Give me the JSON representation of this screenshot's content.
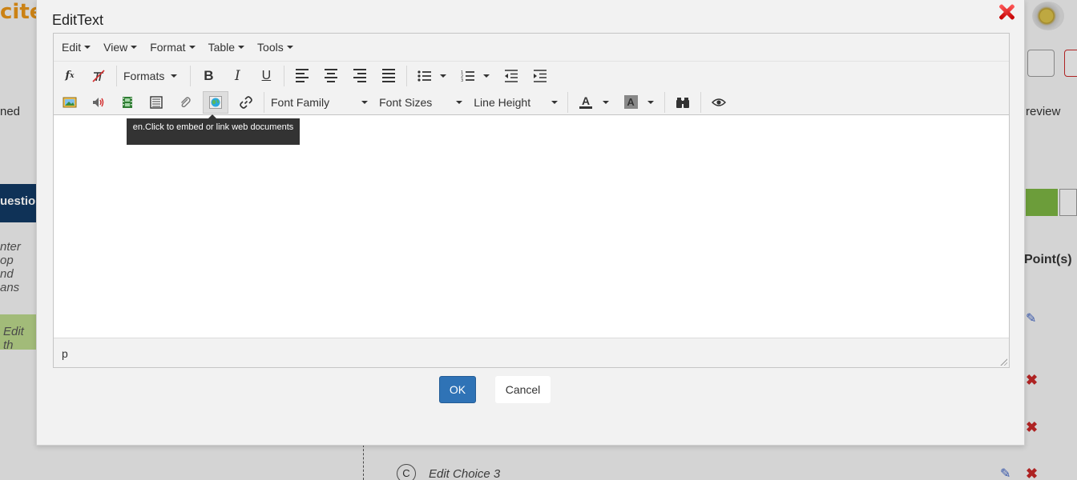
{
  "background": {
    "logo_text": "cite",
    "left_texts": [
      "ned",
      "uestio",
      "nter op",
      "nd ans",
      "Edit th"
    ],
    "right_texts": [
      "review",
      "Point(s)"
    ],
    "choice_letter": "C",
    "choice_text": "Edit Choice 3"
  },
  "dialog": {
    "title": "EditText",
    "menu": [
      "Edit",
      "View",
      "Format",
      "Table",
      "Tools"
    ],
    "toolbar_row1": {
      "formats_label": "Formats"
    },
    "toolbar_row2": {
      "font_family": "Font Family",
      "font_sizes": "Font Sizes",
      "line_height": "Line Height"
    },
    "tooltip": "en.Click to embed or link web documents",
    "status_path": "p",
    "ok_label": "OK",
    "cancel_label": "Cancel"
  },
  "colors": {
    "ok_button": "#2f73b6",
    "close_icon": "#d10000",
    "tooltip_bg": "#333333"
  }
}
